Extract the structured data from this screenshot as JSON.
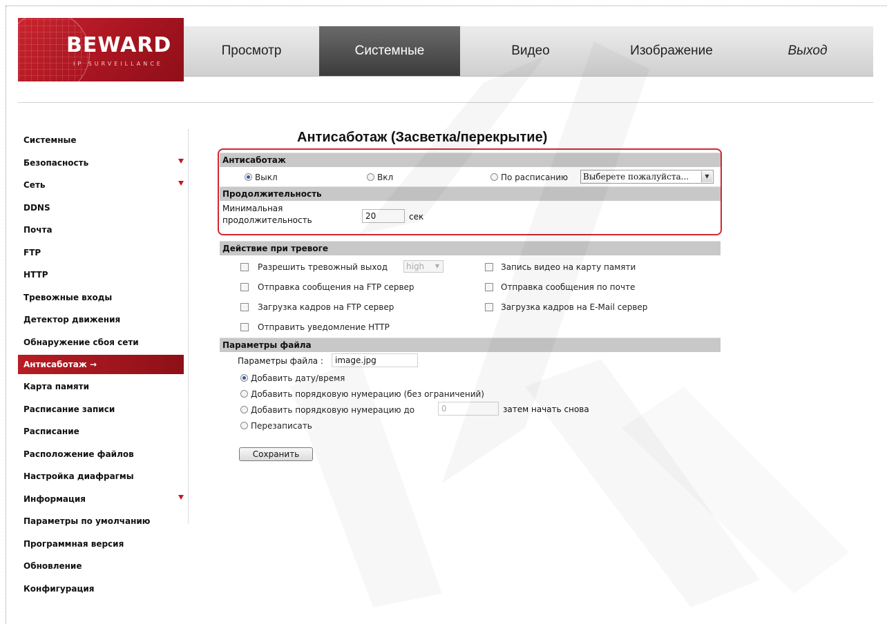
{
  "logo": {
    "brand": "BEWARD",
    "tagline": "IP SURVEILLANCE"
  },
  "nav": [
    {
      "label": "Просмотр",
      "active": false
    },
    {
      "label": "Системные",
      "active": true
    },
    {
      "label": "Видео",
      "active": false
    },
    {
      "label": "Изображение",
      "active": false
    },
    {
      "label": "Выход",
      "active": false
    }
  ],
  "sidebar": {
    "items": [
      {
        "label": "Системные"
      },
      {
        "label": "Безопасность",
        "expandable": true
      },
      {
        "label": "Сеть",
        "expandable": true
      },
      {
        "label": "DDNS"
      },
      {
        "label": "Почта"
      },
      {
        "label": "FTP"
      },
      {
        "label": "HTTP"
      },
      {
        "label": "Тревожные входы"
      },
      {
        "label": "Детектор движения"
      },
      {
        "label": "Обнаружение сбоя сети"
      },
      {
        "label": "Антисаботаж →",
        "active": true
      },
      {
        "label": "Карта памяти"
      },
      {
        "label": "Расписание записи"
      },
      {
        "label": "Расписание"
      },
      {
        "label": "Расположение файлов"
      },
      {
        "label": "Настройка диафрагмы"
      },
      {
        "label": "Информация",
        "expandable": true
      },
      {
        "label": "Параметры по умолчанию"
      },
      {
        "label": "Программная версия"
      },
      {
        "label": "Обновление"
      },
      {
        "label": "Конфигурация"
      }
    ]
  },
  "page": {
    "title": "Антисаботаж (Засветка/перекрытие)"
  },
  "tamper": {
    "header": "Антисаботаж",
    "off_label": "Выкл",
    "on_label": "Вкл",
    "schedule_label": "По расписанию",
    "schedule_select": "Выберете пожалуйста...",
    "selected": "off"
  },
  "duration": {
    "header": "Продолжительность",
    "label_line1": "Минимальная",
    "label_line2": "продолжительность",
    "value": "20",
    "unit": "сек"
  },
  "alarm": {
    "header": "Действие при тревоге",
    "allow_output": "Разрешить тревожный выход",
    "output_level": "high",
    "ftp_message": "Отправка сообщения на FTP сервер",
    "ftp_upload": "Загрузка кадров на FTP сервер",
    "http_notify": "Отправить уведомление HTTP",
    "sd_record": "Запись видео на карту памяти",
    "mail_message": "Отправка сообщения по почте",
    "mail_upload": "Загрузка кадров на E-Mail сервер"
  },
  "file": {
    "header": "Параметры файла",
    "name_label": "Параметры файла :",
    "name_value": "image.jpg",
    "opt_datetime": "Добавить дату/время",
    "opt_seq_unlimited": "Добавить порядковую нумерацию (без ограничений)",
    "opt_seq_upto": "Добавить порядковую нумерацию до",
    "seq_value": "0",
    "seq_suffix": "затем начать снова",
    "opt_overwrite": "Перезаписать",
    "selected": "datetime"
  },
  "actions": {
    "save_label": "Сохранить"
  },
  "colors": {
    "brand_red": "#b81c24",
    "section_gray": "#c8c8c8",
    "highlight": "#d0262f"
  }
}
